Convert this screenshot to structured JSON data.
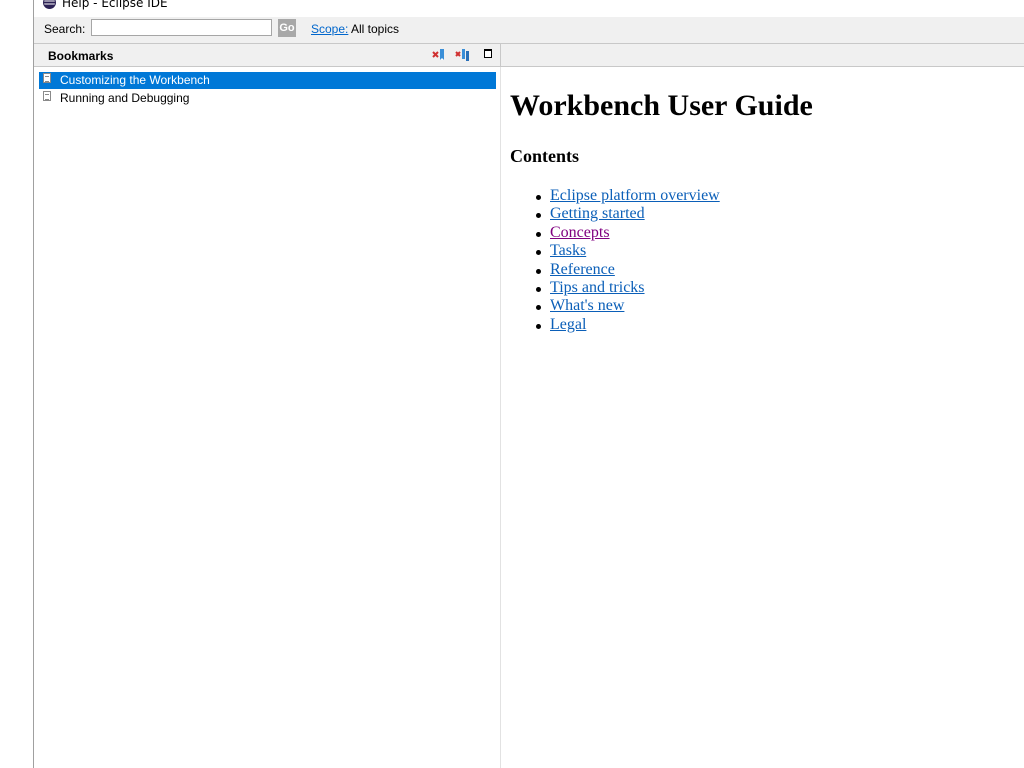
{
  "window": {
    "title": "Help - Eclipse IDE"
  },
  "search": {
    "label": "Search:",
    "value": "",
    "placeholder": "",
    "go_label": "Go"
  },
  "scope": {
    "link_label": "Scope:",
    "value": "All topics"
  },
  "bookmarks": {
    "title": "Bookmarks",
    "toolbar": [
      {
        "name": "delete-bookmark-icon"
      },
      {
        "name": "delete-all-bookmarks-icon"
      },
      {
        "name": "maximize-icon"
      }
    ],
    "items": [
      {
        "label": "Customizing the Workbench",
        "selected": true
      },
      {
        "label": "Running and Debugging",
        "selected": false
      }
    ]
  },
  "content": {
    "title": "Workbench User Guide",
    "contents_heading": "Contents",
    "links": [
      {
        "label": "Eclipse platform overview",
        "visited": false
      },
      {
        "label": "Getting started",
        "visited": false
      },
      {
        "label": "Concepts",
        "visited": true
      },
      {
        "label": "Tasks",
        "visited": false
      },
      {
        "label": "Reference",
        "visited": false
      },
      {
        "label": "Tips and tricks",
        "visited": false
      },
      {
        "label": "What's new",
        "visited": false
      },
      {
        "label": "Legal",
        "visited": false
      }
    ]
  },
  "colors": {
    "selection": "#0078d7",
    "link": "#0b5fb8",
    "visited_link": "#800080",
    "panel_bg": "#f0f0f0"
  }
}
